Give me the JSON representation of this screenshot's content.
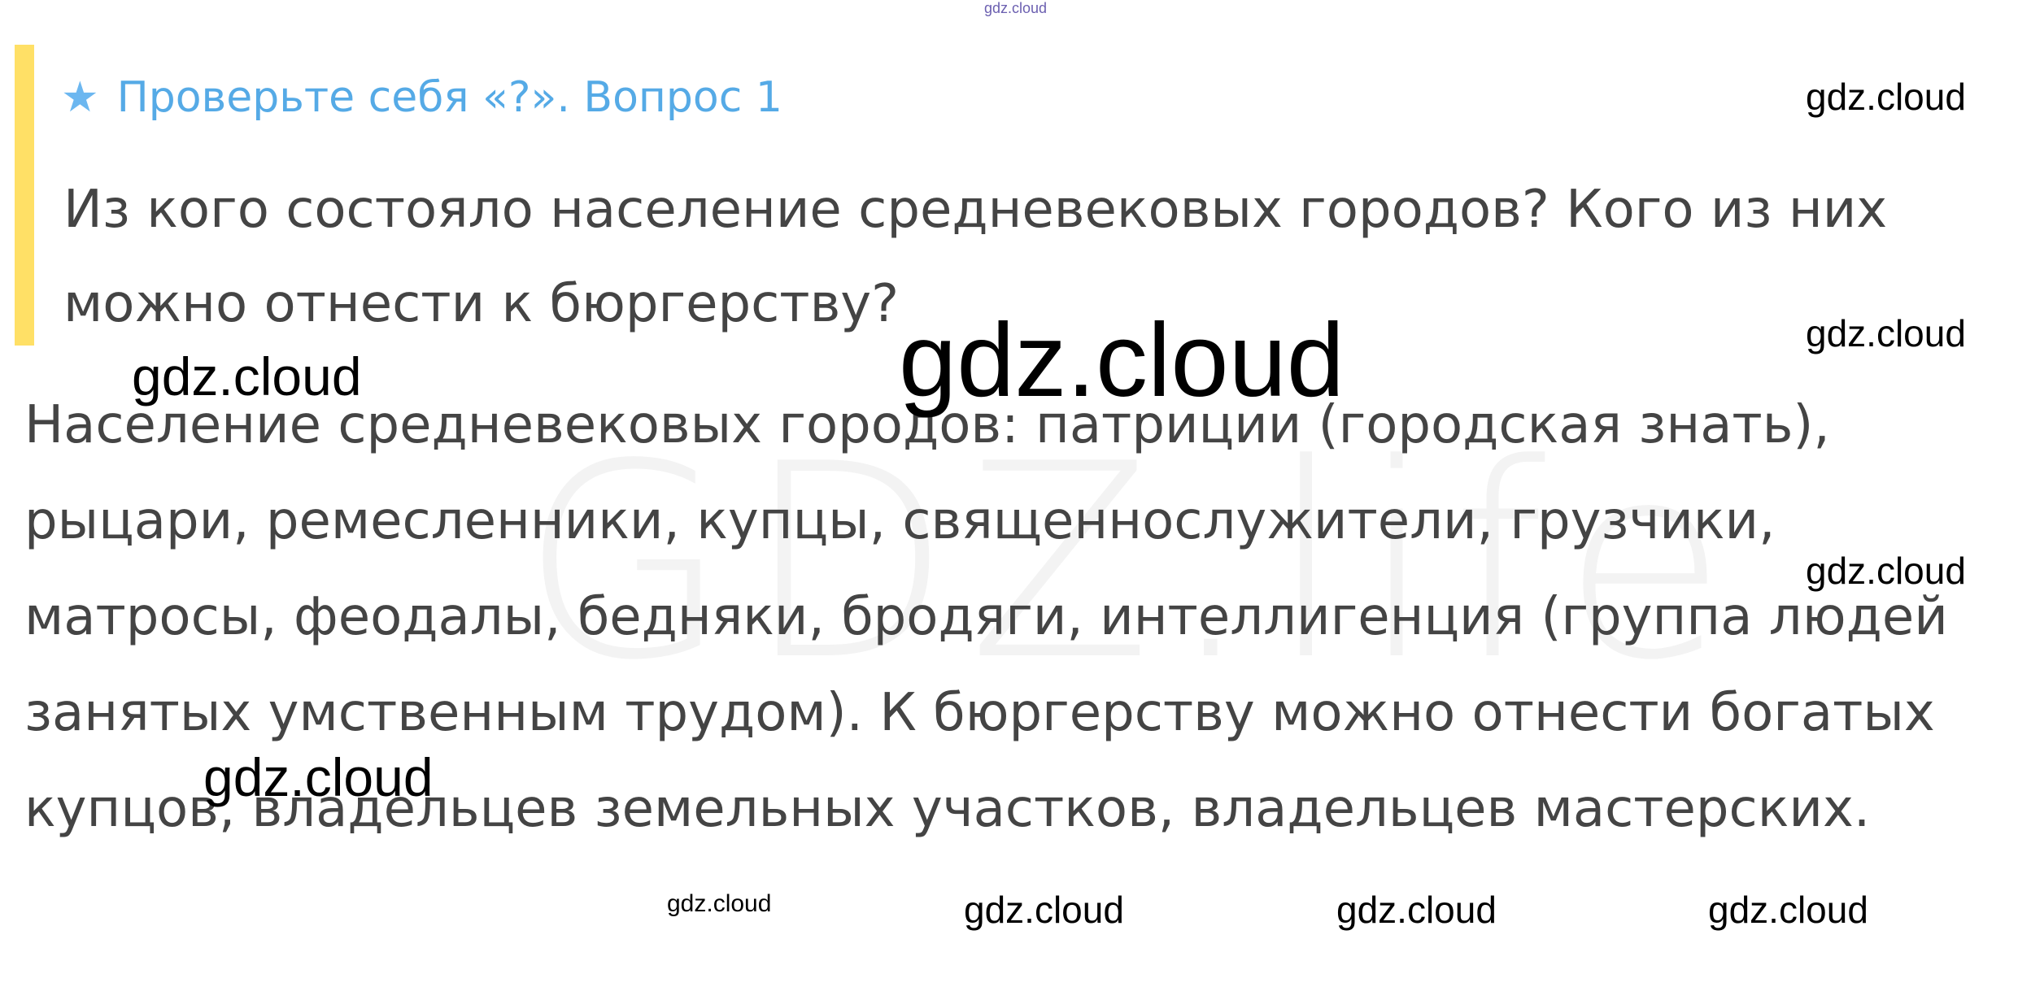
{
  "top_watermark": "gdz.cloud",
  "question": {
    "title": "Проверьте себя «?». Вопрос 1",
    "icon": "star-icon",
    "text": "Из кого состояло население средневековых городов? Кого из них можно отнести к бюргерству?"
  },
  "answer": {
    "text": "Население средневековых городов: патриции (городская знать), рыцари, ремесленники, купцы, священнослужители, грузчики, матросы, феодалы, бедняки, бродяги, интеллигенция (группа людей занятых умственным трудом). К бюргерству можно отнести богатых купцов, владельцев земельных участков, владельцев мастерских."
  },
  "background_watermark": "GDZ.life",
  "watermarks": [
    "gdz.cloud",
    "gdz.cloud",
    "gdz.cloud",
    "gdz.cloud",
    "gdz.cloud",
    "gdz.cloud",
    "gdz.cloud",
    "gdz.cloud",
    "gdz.cloud",
    "gdz.cloud"
  ],
  "colors": {
    "accent_bar": "#ffe066",
    "title": "#55aae6",
    "body_text": "#444444"
  }
}
